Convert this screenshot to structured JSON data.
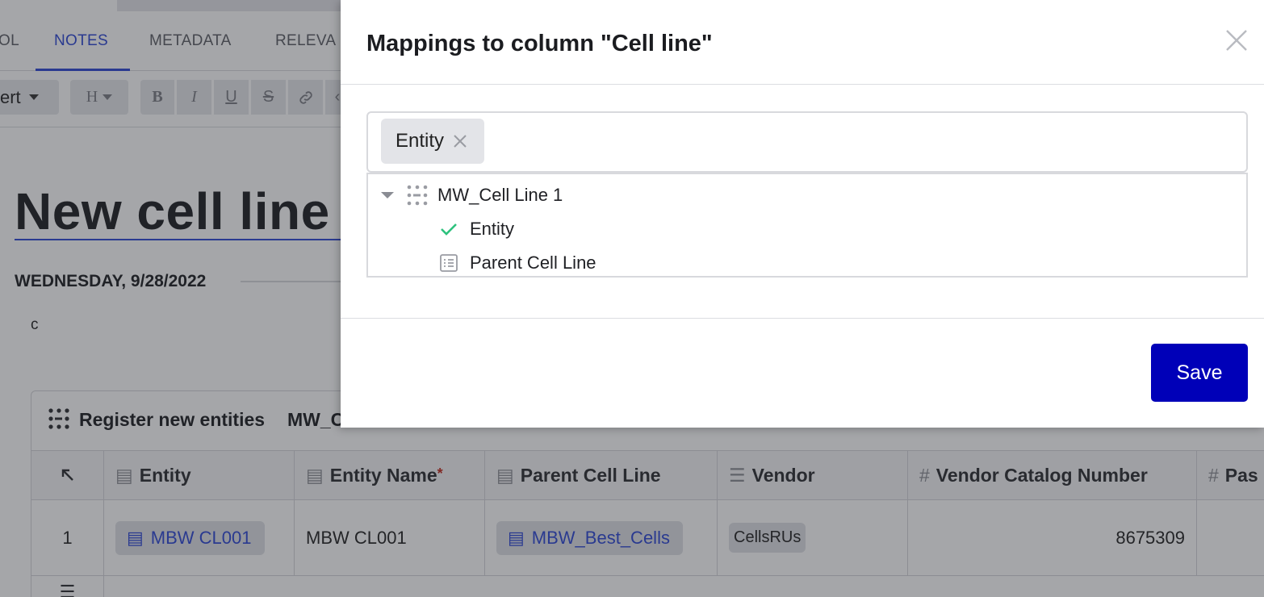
{
  "tabs": [
    {
      "label": "OL"
    },
    {
      "label": "NOTES",
      "active": true
    },
    {
      "label": "METADATA"
    },
    {
      "label": "RELEVA"
    }
  ],
  "toolbar": {
    "insert_label": "ert",
    "heading_label": "H",
    "bold": "B",
    "italic": "I",
    "underline": "U",
    "strike": "S"
  },
  "document": {
    "title": "New cell line",
    "date": "WEDNESDAY, 9/28/2022",
    "note": "c"
  },
  "register_table": {
    "title": "Register new entities",
    "subtitle": "MW_C",
    "columns": [
      "Entity",
      "Entity Name",
      "Parent Cell Line",
      "Vendor",
      "Vendor Catalog Number",
      "Pas"
    ],
    "required_marker": "*",
    "rows": [
      {
        "index": "1",
        "entity": "MBW CL001",
        "entity_name": "MBW CL001",
        "parent_cell_line": "MBW_Best_Cells",
        "vendor": "CellsRUs",
        "vendor_catalog_number": "8675309"
      }
    ]
  },
  "modal": {
    "title": "Mappings to column \"Cell line\"",
    "selected_tag": "Entity",
    "tree": {
      "root": "MW_Cell Line 1",
      "children": [
        {
          "label": "Entity",
          "checked": true
        },
        {
          "label": "Parent Cell Line",
          "checked": false
        }
      ]
    },
    "save_label": "Save"
  },
  "colors": {
    "accent": "#2b46d4",
    "primary_button": "#0000b8",
    "check": "#2ec27e"
  }
}
